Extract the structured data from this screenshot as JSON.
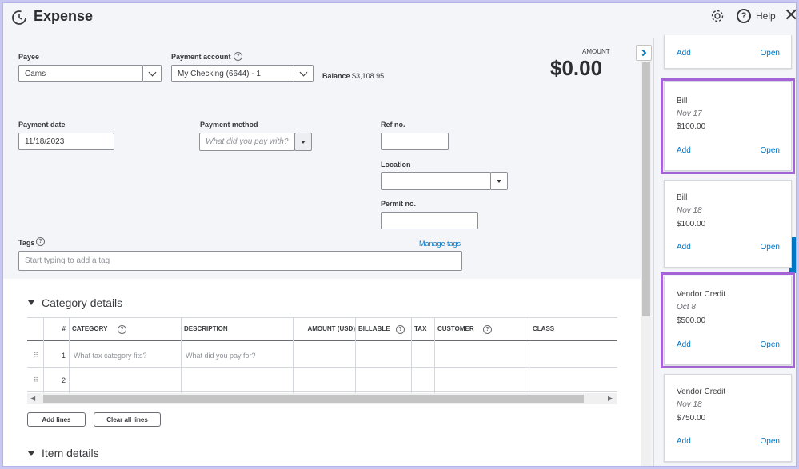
{
  "header": {
    "title": "Expense",
    "help_label": "Help",
    "close_glyph": "✕"
  },
  "form": {
    "payee": {
      "label": "Payee",
      "value": "Cams"
    },
    "payment_account": {
      "label": "Payment account",
      "value": "My Checking (6644) - 1"
    },
    "balance": {
      "label": "Balance",
      "value": "$3,108.95"
    },
    "amount": {
      "label": "AMOUNT",
      "value": "$0.00"
    },
    "payment_date": {
      "label": "Payment date",
      "value": "11/18/2023"
    },
    "payment_method": {
      "label": "Payment method",
      "placeholder": "What did you pay with?"
    },
    "ref_no": {
      "label": "Ref no.",
      "value": ""
    },
    "location": {
      "label": "Location",
      "value": ""
    },
    "permit_no": {
      "label": "Permit no.",
      "value": ""
    },
    "tags": {
      "label": "Tags",
      "placeholder": "Start typing to add a tag",
      "manage_link": "Manage tags"
    }
  },
  "category_details": {
    "title": "Category details",
    "columns": [
      "#",
      "CATEGORY",
      "DESCRIPTION",
      "AMOUNT (USD)",
      "BILLABLE",
      "TAX",
      "CUSTOMER",
      "CLASS"
    ],
    "rows": [
      {
        "num": "1",
        "category_placeholder": "What tax category fits?",
        "description_placeholder": "What did you pay for?"
      },
      {
        "num": "2",
        "category_placeholder": "",
        "description_placeholder": ""
      }
    ],
    "add_lines": "Add lines",
    "clear_all_lines": "Clear all lines"
  },
  "item_details": {
    "title": "Item details"
  },
  "side_panel": {
    "cards": [
      {
        "type": "",
        "date": "",
        "amount": "",
        "add": "Add",
        "open": "Open",
        "highlighted": false
      },
      {
        "type": "Bill",
        "date": "Nov 17",
        "amount": "$100.00",
        "add": "Add",
        "open": "Open",
        "highlighted": true
      },
      {
        "type": "Bill",
        "date": "Nov 18",
        "amount": "$100.00",
        "add": "Add",
        "open": "Open",
        "highlighted": false
      },
      {
        "type": "Vendor Credit",
        "date": "Oct 8",
        "amount": "$500.00",
        "add": "Add",
        "open": "Open",
        "highlighted": true
      },
      {
        "type": "Vendor Credit",
        "date": "Nov 18",
        "amount": "$750.00",
        "add": "Add",
        "open": "Open",
        "highlighted": false
      }
    ]
  },
  "colors": {
    "link": "#0077c5",
    "highlight": "#a463d6",
    "background": "#f4f5f8"
  }
}
